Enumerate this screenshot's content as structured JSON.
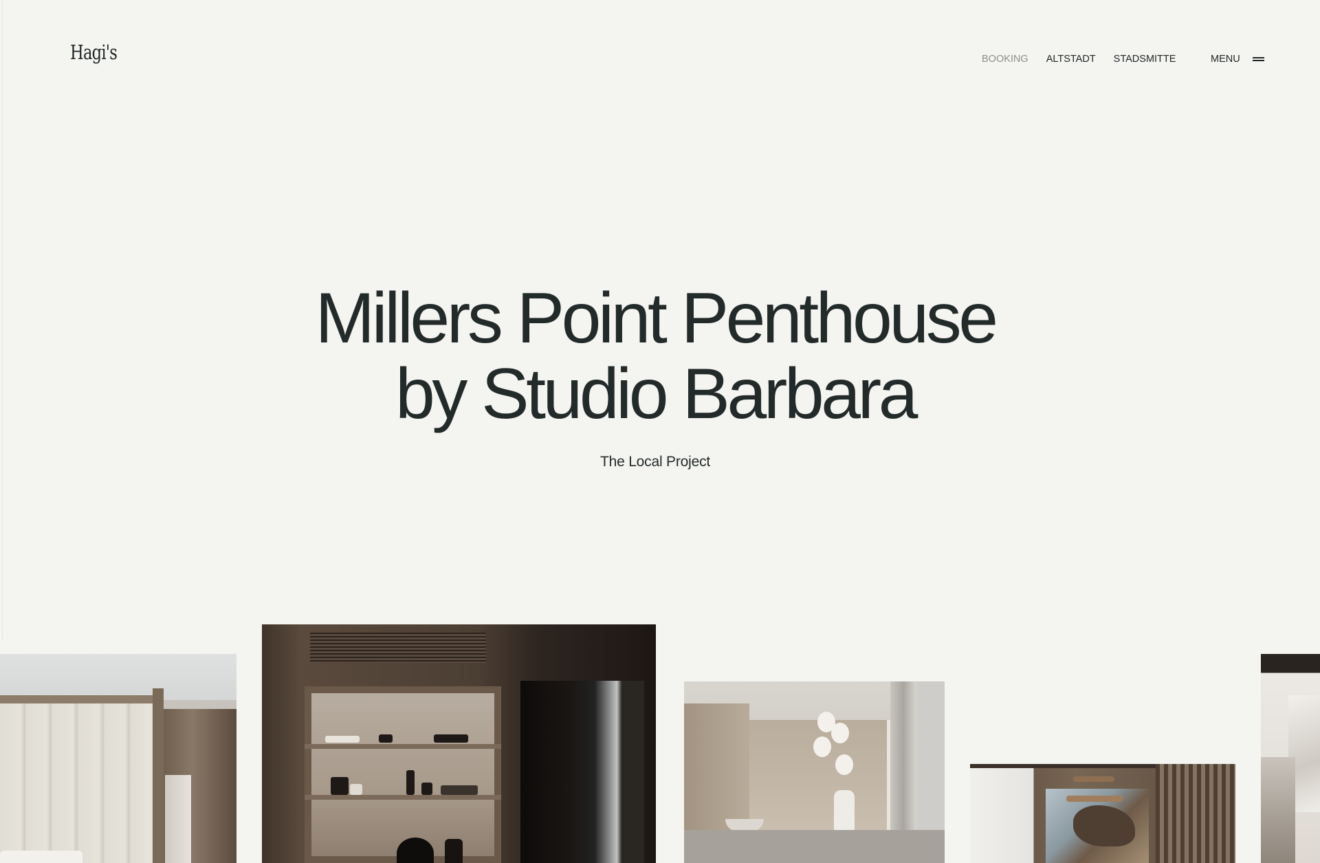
{
  "header": {
    "logo": "Hagi's",
    "nav": [
      {
        "label": "BOOKING",
        "active": true
      },
      {
        "label": "ALTSTADT",
        "active": false
      },
      {
        "label": "STADSMITTE",
        "active": false
      }
    ],
    "menu_label": "MENU",
    "menu_icon": "hamburger-icon"
  },
  "hero": {
    "title_line1": "Millers Point Penthouse",
    "title_line2": "by Studio Barbara",
    "subtitle": "The Local Project"
  },
  "colors": {
    "background": "#f4f4f1",
    "text": "#232b2a",
    "nav_active": "#8c8f8e"
  }
}
